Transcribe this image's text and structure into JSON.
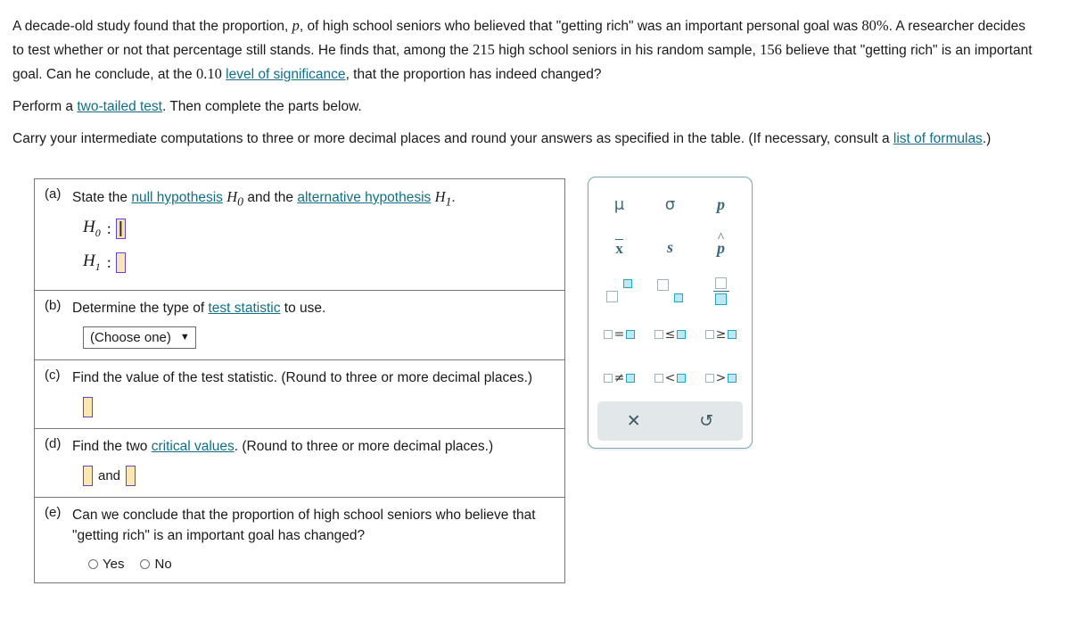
{
  "problem": {
    "line1_a": "A decade-old study found that the proportion, ",
    "line1_var": "p",
    "line1_b": ", of high school seniors who believed that \"getting rich\" was an important personal goal was ",
    "line1_pct": "80%",
    "line1_c": ". A researcher decides to test whether or not that percentage still stands. He finds that, among the ",
    "n_value": "215",
    "line1_d": " high school seniors in his random sample, ",
    "x_value": "156",
    "line1_e": " believe that \"getting rich\" is an important goal. Can he conclude, at the ",
    "alpha_value": "0.10",
    "link_significance": "level of significance",
    "line1_f": ", that the proportion has indeed changed?",
    "perform_a": "Perform a ",
    "link_twotailed": "two-tailed test",
    "perform_b": ". Then complete the parts below.",
    "carry_a": "Carry your intermediate computations to three or more decimal places and round your answers as specified in the table. (If necessary, consult a ",
    "link_formulas": "list of formulas",
    "carry_b": ".)"
  },
  "parts": {
    "a": {
      "tag": "(a)",
      "text_a": "State the ",
      "link_null": "null hypothesis",
      "h0": "H",
      "h0_sub": "0",
      "text_b": " and the ",
      "link_alt": "alternative hypothesis",
      "h1": "H",
      "h1_sub": "1",
      "text_c": ".",
      "row0_label": "H",
      "row0_sub": "0",
      "row0_colon": ":",
      "row1_label": "H",
      "row1_sub": "1",
      "row1_colon": ":",
      "h0_value": "",
      "h1_value": ""
    },
    "b": {
      "tag": "(b)",
      "text_a": "Determine the type of ",
      "link_teststat": "test statistic",
      "text_b": " to use.",
      "select_value": "(Choose one)",
      "select_caret": "▼"
    },
    "c": {
      "tag": "(c)",
      "text": "Find the value of the test statistic. (Round to three or more decimal places.)",
      "value": ""
    },
    "d": {
      "tag": "(d)",
      "text_a": "Find the two ",
      "link_critical": "critical values",
      "text_b": ". (Round to three or more decimal places.)",
      "and_label": "and",
      "value1": "",
      "value2": ""
    },
    "e": {
      "tag": "(e)",
      "text": "Can we conclude that the proportion of high school seniors who believe that \"getting rich\" is an important goal has changed?",
      "options": [
        "Yes",
        "No"
      ],
      "selected": ""
    }
  },
  "palette": {
    "cells": [
      {
        "id": "mu",
        "name": "symbol-mu",
        "glyph": "μ"
      },
      {
        "id": "sigma",
        "name": "symbol-sigma",
        "glyph": "σ"
      },
      {
        "id": "p",
        "name": "symbol-p",
        "glyph": "p"
      },
      {
        "id": "xbar",
        "name": "symbol-x-bar",
        "glyph": "x"
      },
      {
        "id": "s",
        "name": "symbol-s",
        "glyph": "s"
      },
      {
        "id": "phat",
        "name": "symbol-p-hat",
        "glyph": "p"
      },
      {
        "id": "sup",
        "name": "superscript-icon",
        "glyph": ""
      },
      {
        "id": "sub",
        "name": "subscript-icon",
        "glyph": ""
      },
      {
        "id": "frac",
        "name": "fraction-icon",
        "glyph": ""
      },
      {
        "id": "eq",
        "name": "operator-equals",
        "glyph": "="
      },
      {
        "id": "le",
        "name": "operator-less-equal",
        "glyph": "≤"
      },
      {
        "id": "ge",
        "name": "operator-greater-equal",
        "glyph": "≥"
      },
      {
        "id": "ne",
        "name": "operator-not-equal",
        "glyph": "≠"
      },
      {
        "id": "lt",
        "name": "operator-less-than",
        "glyph": "<"
      },
      {
        "id": "gt",
        "name": "operator-greater-than",
        "glyph": ">"
      }
    ],
    "clear_glyph": "✕",
    "undo_glyph": "↺",
    "accent_color": "#22a5c4",
    "symbol_color": "#3c6a78"
  }
}
